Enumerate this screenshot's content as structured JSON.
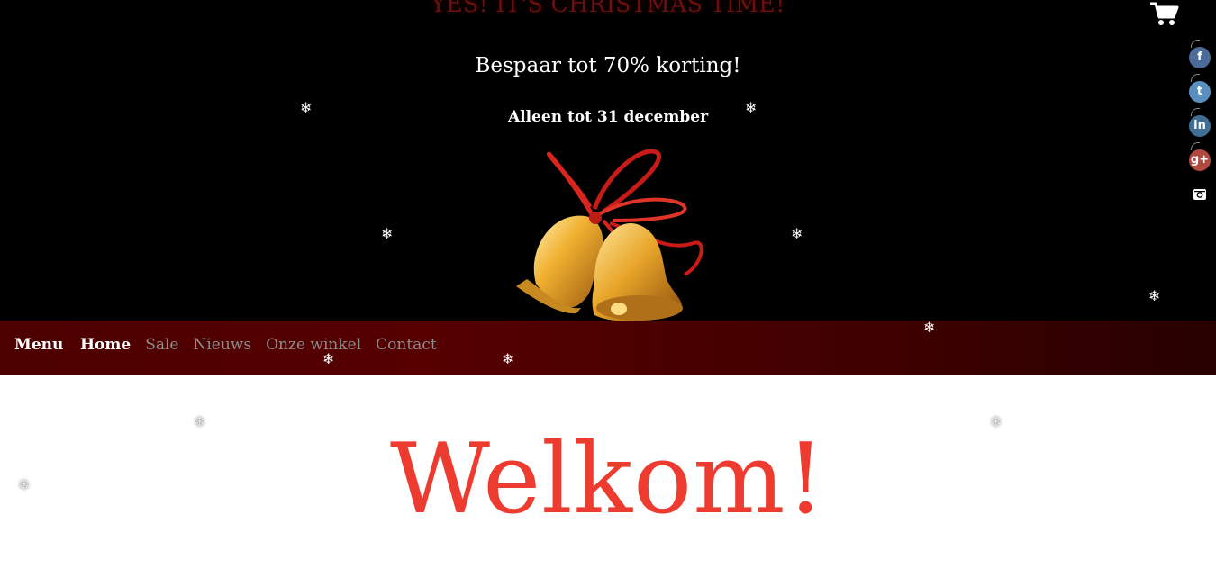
{
  "banner": {
    "title": "YES! IT'S CHRISTMAS TIME!",
    "subtitle": "Bespaar tot 70% korting!",
    "note": "Alleen tot 31 december"
  },
  "header": {
    "cart_icon": "shopping-cart-icon"
  },
  "social": [
    {
      "name": "facebook-icon",
      "glyph": "f"
    },
    {
      "name": "twitter-icon",
      "glyph": "t"
    },
    {
      "name": "linkedin-icon",
      "glyph": "in"
    },
    {
      "name": "google-plus-icon",
      "glyph": "g+"
    },
    {
      "name": "instagram-icon",
      "glyph": ""
    }
  ],
  "nav": {
    "menu_label": "Menu",
    "items": [
      {
        "label": "Home"
      },
      {
        "label": "Sale"
      },
      {
        "label": "Nieuws"
      },
      {
        "label": "Onze winkel"
      },
      {
        "label": "Contact"
      }
    ]
  },
  "main": {
    "heading": "Welkom!"
  },
  "decor": {
    "snowflake_glyph": "❄",
    "bells_image": "christmas-bells-icon"
  },
  "colors": {
    "hero_bg": "#000000",
    "nav_bg": "#4c0000",
    "heading": "#ee3b2f",
    "title_red": "#6e0f0f"
  }
}
